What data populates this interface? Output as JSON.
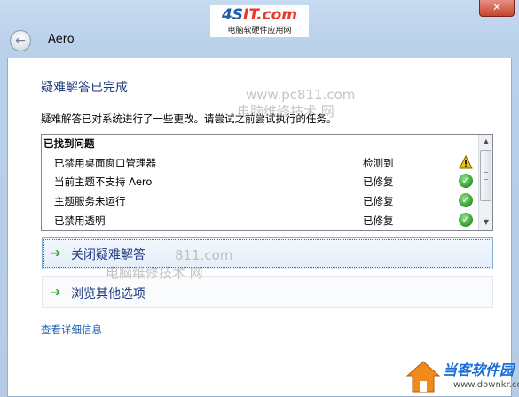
{
  "logo": {
    "main_a": "4S",
    "main_b": "IT.com",
    "sub": "电脑软硬件应用网"
  },
  "window": {
    "title": "Aero",
    "close_symbol": "✕",
    "back_symbol": "←"
  },
  "page": {
    "heading": "疑难解答已完成",
    "description": "疑难解答已对系统进行了一些更改。请尝试之前尝试执行的任务。"
  },
  "issues": {
    "header": "已找到问题",
    "rows": [
      {
        "name": "已禁用桌面窗口管理器",
        "status": "检测到",
        "icon": "warning-icon"
      },
      {
        "name": "当前主题不支持 Aero",
        "status": "已修复",
        "icon": "check-icon"
      },
      {
        "name": "主题服务未运行",
        "status": "已修复",
        "icon": "check-icon"
      },
      {
        "name": "已禁用透明",
        "status": "已修复",
        "icon": "check-icon"
      }
    ]
  },
  "commands": [
    {
      "label": "关闭疑难解答",
      "icon": "green-arrow-icon"
    },
    {
      "label": "浏览其他选项",
      "icon": "green-arrow-icon"
    }
  ],
  "details_link": "查看详细信息",
  "watermarks": {
    "site": "www.pc811.com",
    "tagline": "电脑维修技术 网",
    "site_partial": "811.com",
    "tagline2": "电脑维修技术 网",
    "brand_name": "当客软件园",
    "brand_url": "www.downkr.com"
  },
  "colors": {
    "heading": "#1e3a80",
    "link": "#1a5fb4",
    "ok": "#2e9a2b",
    "warn": "#f2c400"
  }
}
